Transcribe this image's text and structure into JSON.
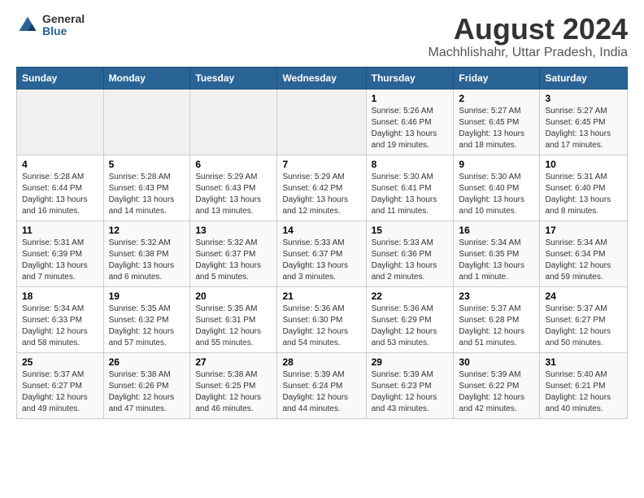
{
  "logo": {
    "general": "General",
    "blue": "Blue"
  },
  "header": {
    "title": "August 2024",
    "subtitle": "Machhlishahr, Uttar Pradesh, India"
  },
  "weekdays": [
    "Sunday",
    "Monday",
    "Tuesday",
    "Wednesday",
    "Thursday",
    "Friday",
    "Saturday"
  ],
  "weeks": [
    [
      {
        "day": "",
        "info": ""
      },
      {
        "day": "",
        "info": ""
      },
      {
        "day": "",
        "info": ""
      },
      {
        "day": "",
        "info": ""
      },
      {
        "day": "1",
        "info": "Sunrise: 5:26 AM\nSunset: 6:46 PM\nDaylight: 13 hours\nand 19 minutes."
      },
      {
        "day": "2",
        "info": "Sunrise: 5:27 AM\nSunset: 6:45 PM\nDaylight: 13 hours\nand 18 minutes."
      },
      {
        "day": "3",
        "info": "Sunrise: 5:27 AM\nSunset: 6:45 PM\nDaylight: 13 hours\nand 17 minutes."
      }
    ],
    [
      {
        "day": "4",
        "info": "Sunrise: 5:28 AM\nSunset: 6:44 PM\nDaylight: 13 hours\nand 16 minutes."
      },
      {
        "day": "5",
        "info": "Sunrise: 5:28 AM\nSunset: 6:43 PM\nDaylight: 13 hours\nand 14 minutes."
      },
      {
        "day": "6",
        "info": "Sunrise: 5:29 AM\nSunset: 6:43 PM\nDaylight: 13 hours\nand 13 minutes."
      },
      {
        "day": "7",
        "info": "Sunrise: 5:29 AM\nSunset: 6:42 PM\nDaylight: 13 hours\nand 12 minutes."
      },
      {
        "day": "8",
        "info": "Sunrise: 5:30 AM\nSunset: 6:41 PM\nDaylight: 13 hours\nand 11 minutes."
      },
      {
        "day": "9",
        "info": "Sunrise: 5:30 AM\nSunset: 6:40 PM\nDaylight: 13 hours\nand 10 minutes."
      },
      {
        "day": "10",
        "info": "Sunrise: 5:31 AM\nSunset: 6:40 PM\nDaylight: 13 hours\nand 8 minutes."
      }
    ],
    [
      {
        "day": "11",
        "info": "Sunrise: 5:31 AM\nSunset: 6:39 PM\nDaylight: 13 hours\nand 7 minutes."
      },
      {
        "day": "12",
        "info": "Sunrise: 5:32 AM\nSunset: 6:38 PM\nDaylight: 13 hours\nand 6 minutes."
      },
      {
        "day": "13",
        "info": "Sunrise: 5:32 AM\nSunset: 6:37 PM\nDaylight: 13 hours\nand 5 minutes."
      },
      {
        "day": "14",
        "info": "Sunrise: 5:33 AM\nSunset: 6:37 PM\nDaylight: 13 hours\nand 3 minutes."
      },
      {
        "day": "15",
        "info": "Sunrise: 5:33 AM\nSunset: 6:36 PM\nDaylight: 13 hours\nand 2 minutes."
      },
      {
        "day": "16",
        "info": "Sunrise: 5:34 AM\nSunset: 6:35 PM\nDaylight: 13 hours\nand 1 minute."
      },
      {
        "day": "17",
        "info": "Sunrise: 5:34 AM\nSunset: 6:34 PM\nDaylight: 12 hours\nand 59 minutes."
      }
    ],
    [
      {
        "day": "18",
        "info": "Sunrise: 5:34 AM\nSunset: 6:33 PM\nDaylight: 12 hours\nand 58 minutes."
      },
      {
        "day": "19",
        "info": "Sunrise: 5:35 AM\nSunset: 6:32 PM\nDaylight: 12 hours\nand 57 minutes."
      },
      {
        "day": "20",
        "info": "Sunrise: 5:35 AM\nSunset: 6:31 PM\nDaylight: 12 hours\nand 55 minutes."
      },
      {
        "day": "21",
        "info": "Sunrise: 5:36 AM\nSunset: 6:30 PM\nDaylight: 12 hours\nand 54 minutes."
      },
      {
        "day": "22",
        "info": "Sunrise: 5:36 AM\nSunset: 6:29 PM\nDaylight: 12 hours\nand 53 minutes."
      },
      {
        "day": "23",
        "info": "Sunrise: 5:37 AM\nSunset: 6:28 PM\nDaylight: 12 hours\nand 51 minutes."
      },
      {
        "day": "24",
        "info": "Sunrise: 5:37 AM\nSunset: 6:27 PM\nDaylight: 12 hours\nand 50 minutes."
      }
    ],
    [
      {
        "day": "25",
        "info": "Sunrise: 5:37 AM\nSunset: 6:27 PM\nDaylight: 12 hours\nand 49 minutes."
      },
      {
        "day": "26",
        "info": "Sunrise: 5:38 AM\nSunset: 6:26 PM\nDaylight: 12 hours\nand 47 minutes."
      },
      {
        "day": "27",
        "info": "Sunrise: 5:38 AM\nSunset: 6:25 PM\nDaylight: 12 hours\nand 46 minutes."
      },
      {
        "day": "28",
        "info": "Sunrise: 5:39 AM\nSunset: 6:24 PM\nDaylight: 12 hours\nand 44 minutes."
      },
      {
        "day": "29",
        "info": "Sunrise: 5:39 AM\nSunset: 6:23 PM\nDaylight: 12 hours\nand 43 minutes."
      },
      {
        "day": "30",
        "info": "Sunrise: 5:39 AM\nSunset: 6:22 PM\nDaylight: 12 hours\nand 42 minutes."
      },
      {
        "day": "31",
        "info": "Sunrise: 5:40 AM\nSunset: 6:21 PM\nDaylight: 12 hours\nand 40 minutes."
      }
    ]
  ]
}
